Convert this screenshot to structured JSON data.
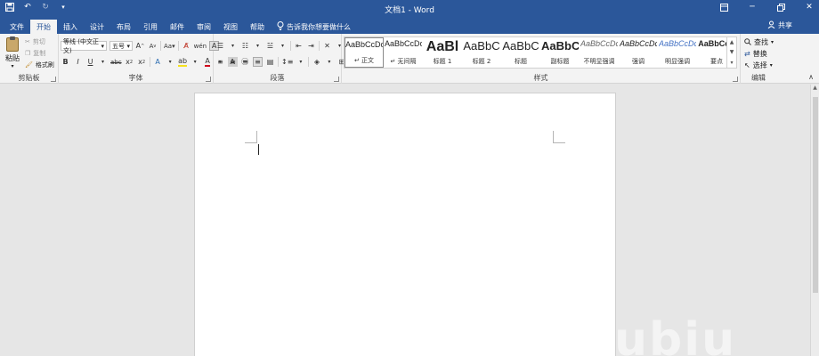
{
  "titlebar": {
    "title": "文档1 - Word",
    "qat": {
      "save_icon": "save-icon",
      "undo_icon": "undo-icon",
      "redo_icon": "redo-icon",
      "customize_icon": "customize-qat-icon"
    },
    "controls": {
      "ribbon_display_icon": "ribbon-display-icon",
      "minimize_icon": "minimize-icon",
      "restore_icon": "restore-icon",
      "close_icon": "close-icon"
    }
  },
  "tabs": [
    {
      "label": "文件"
    },
    {
      "label": "开始"
    },
    {
      "label": "插入"
    },
    {
      "label": "设计"
    },
    {
      "label": "布局"
    },
    {
      "label": "引用"
    },
    {
      "label": "邮件"
    },
    {
      "label": "审阅"
    },
    {
      "label": "视图"
    },
    {
      "label": "帮助"
    }
  ],
  "tell_me": {
    "text": "告诉我你想要做什么"
  },
  "share": {
    "label": "共享"
  },
  "clipboard": {
    "label": "剪贴板",
    "paste": "粘贴",
    "cut": "剪切",
    "copy": "复制",
    "format_painter": "格式刷"
  },
  "font": {
    "label": "字体",
    "font_name": "等线 (中文正文)",
    "font_size": "五号"
  },
  "paragraph": {
    "label": "段落"
  },
  "styles": {
    "label": "样式",
    "items": [
      {
        "sample": "AaBbCcDc",
        "name": "↵ 正文"
      },
      {
        "sample": "AaBbCcDc",
        "name": "↵ 无间隔"
      },
      {
        "sample": "AaBl",
        "name": "标题 1"
      },
      {
        "sample": "AaBbC",
        "name": "标题 2"
      },
      {
        "sample": "AaBbC",
        "name": "标题"
      },
      {
        "sample": "AaBbC",
        "name": "副标题"
      },
      {
        "sample": "AaBbCcDc",
        "name": "不明显强调"
      },
      {
        "sample": "AaBbCcDc",
        "name": "强调"
      },
      {
        "sample": "AaBbCcDc",
        "name": "明显强调"
      },
      {
        "sample": "AaBbCcD",
        "name": "要点"
      }
    ]
  },
  "editing": {
    "label": "编辑",
    "find": "查找",
    "replace": "替换",
    "select": "选择"
  },
  "watermark": "ubiu"
}
